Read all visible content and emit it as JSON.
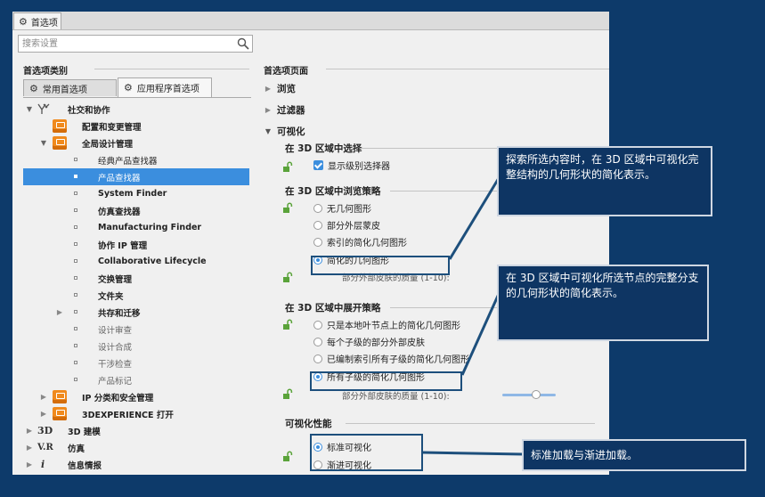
{
  "window": {
    "tab_title": "首选项"
  },
  "search": {
    "placeholder": "搜索设置"
  },
  "left": {
    "section_title": "首选项类别",
    "tabs": [
      {
        "label": "常用首选项",
        "active": false
      },
      {
        "label": "应用程序首选项",
        "active": true
      }
    ],
    "tree": [
      {
        "label": "社交和协作",
        "expanded": true
      },
      {
        "label": "配置和变更管理"
      },
      {
        "label": "全局设计管理",
        "expanded": true
      },
      {
        "label": "经典产品查找器"
      },
      {
        "label": "产品查找器",
        "selected": true
      },
      {
        "label": "System Finder"
      },
      {
        "label": "仿真查找器"
      },
      {
        "label": "Manufacturing Finder"
      },
      {
        "label": "协作 IP 管理"
      },
      {
        "label": "Collaborative Lifecycle"
      },
      {
        "label": "交换管理"
      },
      {
        "label": "文件夹"
      },
      {
        "label": "共存和迁移"
      },
      {
        "label": "设计审查"
      },
      {
        "label": "设计合成"
      },
      {
        "label": "干涉检查"
      },
      {
        "label": "产品标记"
      },
      {
        "label": "IP 分类和安全管理"
      },
      {
        "label": "3DEXPERIENCE 打开"
      },
      {
        "label": "3D 建模",
        "symbol": "3D"
      },
      {
        "label": "仿真",
        "symbol": "V.R"
      },
      {
        "label": "信息情报",
        "symbol": "i"
      }
    ]
  },
  "right": {
    "section_title": "首选项页面",
    "sections": [
      {
        "label": "浏览",
        "expanded": false
      },
      {
        "label": "过滤器",
        "expanded": false
      },
      {
        "label": "可视化",
        "expanded": true
      }
    ],
    "group_select": {
      "title": "在 3D 区域中选择",
      "checkbox_label": "显示级别选择器",
      "checked": true
    },
    "group_browse": {
      "title": "在 3D 区域中浏览策略",
      "options": [
        "无几何图形",
        "部分外层蒙皮",
        "索引的简化几何图形",
        "简化的几何图形"
      ],
      "selected_index": 3,
      "quality_label": "部分外部皮肤的质量 (1-10):"
    },
    "group_expand": {
      "title": "在 3D 区域中展开策略",
      "options": [
        "只是本地叶节点上的简化几何图形",
        "每个子级的部分外部皮肤",
        "已编制索引所有子级的简化几何图形",
        "所有子级的简化几何图形"
      ],
      "selected_index": 3,
      "quality_label": "部分外部皮肤的质量 (1-10):",
      "quality_value_fraction": 0.65
    },
    "group_perf": {
      "title": "可视化性能",
      "options": [
        "标准可视化",
        "渐进可视化"
      ],
      "selected_index": 0
    }
  },
  "callouts": {
    "browse": "探索所选内容时，在 3D 区域中可视化完整结构的几何形状的简化表示。",
    "expand": "在 3D 区域中可视化所选节点的完整分支的几何形状的简化表示。",
    "perf": "标准加载与渐进加载。"
  },
  "colors": {
    "background": "#0d3a6a",
    "accent": "#3b8ede",
    "callout_bg": "#0e3563",
    "highlight_border": "#1d4f7c"
  }
}
